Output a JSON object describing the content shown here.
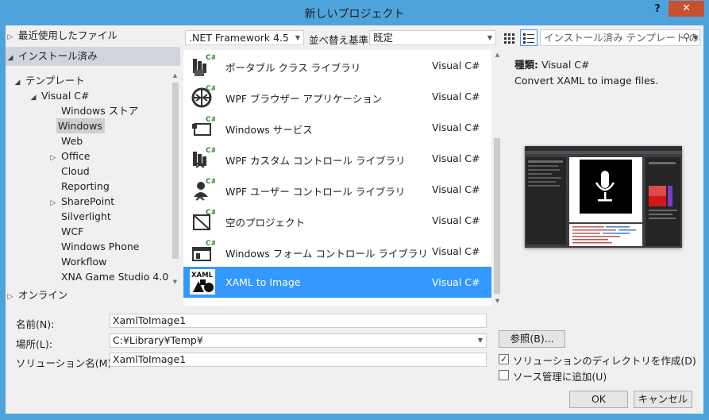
{
  "window": {
    "title": "新しいプロジェクト",
    "help": "?",
    "close": "✕"
  },
  "nav": {
    "recent": "最近使用したファイル",
    "installed": "インストール済み",
    "online": "オンライン",
    "tree": [
      {
        "label": "テンプレート",
        "expander": "◢"
      },
      {
        "label": "Visual C#",
        "expander": "◢"
      },
      {
        "label": "Windows ストア",
        "expander": ""
      },
      {
        "label": "Windows",
        "expander": ""
      },
      {
        "label": "Web",
        "expander": ""
      },
      {
        "label": "Office",
        "expander": "▷"
      },
      {
        "label": "Cloud",
        "expander": ""
      },
      {
        "label": "Reporting",
        "expander": ""
      },
      {
        "label": "SharePoint",
        "expander": "▷"
      },
      {
        "label": "Silverlight",
        "expander": ""
      },
      {
        "label": "WCF",
        "expander": ""
      },
      {
        "label": "Windows Phone",
        "expander": ""
      },
      {
        "label": "Workflow",
        "expander": ""
      },
      {
        "label": "XNA Game Studio 4.0",
        "expander": ""
      }
    ]
  },
  "toolbar": {
    "framework": ".NET Framework 4.5",
    "sort_label": "並べ替え基準:",
    "sort_value": "既定",
    "search_placeholder": "インストール済み テンプレート の検"
  },
  "templates": [
    {
      "name": "ポータブル クラス ライブラリ",
      "lang": "Visual C#",
      "icon": "portable-library-icon"
    },
    {
      "name": "WPF ブラウザー アプリケーション",
      "lang": "Visual C#",
      "icon": "wpf-browser-icon"
    },
    {
      "name": "Windows サービス",
      "lang": "Visual C#",
      "icon": "windows-service-icon"
    },
    {
      "name": "WPF カスタム コントロール ライブラリ",
      "lang": "Visual C#",
      "icon": "wpf-custom-control-icon"
    },
    {
      "name": "WPF ユーザー コントロール ライブラリ",
      "lang": "Visual C#",
      "icon": "wpf-user-control-icon"
    },
    {
      "name": "空のプロジェクト",
      "lang": "Visual C#",
      "icon": "empty-project-icon"
    },
    {
      "name": "Windows フォーム コントロール ライブラリ",
      "lang": "Visual C#",
      "icon": "forms-control-icon"
    },
    {
      "name": "XAML to Image",
      "lang": "Visual C#",
      "icon": "xaml-icon"
    }
  ],
  "details": {
    "type_label": "種類:",
    "type_value": "Visual C#",
    "description": "Convert XAML to image files."
  },
  "form": {
    "name_label": "名前(N):",
    "name_value": "XamlToImage1",
    "location_label": "場所(L):",
    "location_value": "C:¥Library¥Temp¥",
    "solution_label": "ソリューション名(M):",
    "solution_value": "XamlToImage1",
    "browse": "参照(B)...",
    "create_dir_label": "ソリューションのディレクトリを作成(D)",
    "create_dir_checked": true,
    "add_sc_label": "ソース管理に追加(U)",
    "add_sc_checked": false,
    "ok": "OK",
    "cancel": "キャンセル"
  },
  "colors": {
    "accent": "#3399ff",
    "title_bg": "#4fa3dc",
    "close": "#c7502f",
    "nav_selected": "#cfd4dd"
  }
}
